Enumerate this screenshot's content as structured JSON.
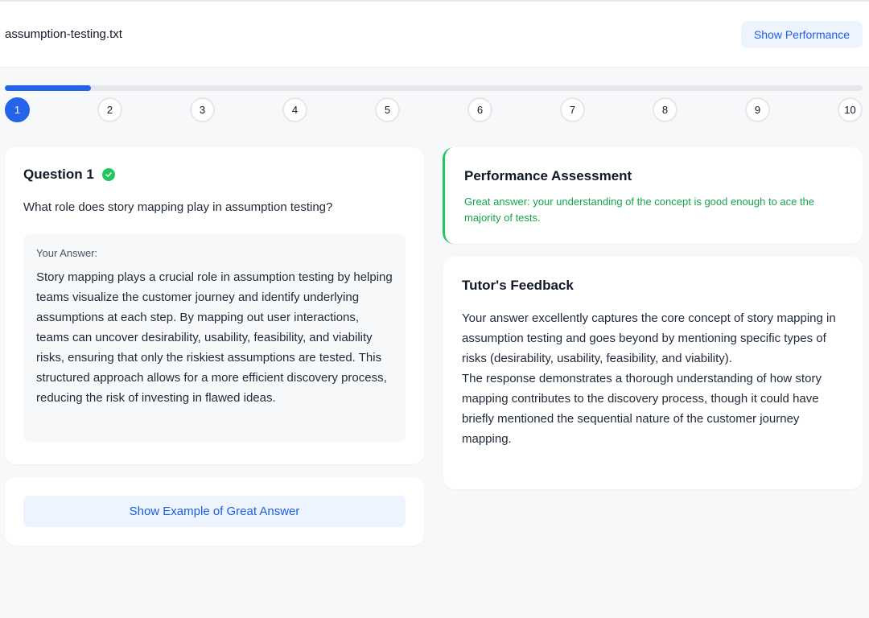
{
  "header": {
    "filename": "assumption-testing.txt",
    "show_performance_label": "Show Performance"
  },
  "progress": {
    "current_step": 1,
    "total_steps": 10,
    "fraction": 0.1,
    "steps": [
      "1",
      "2",
      "3",
      "4",
      "5",
      "6",
      "7",
      "8",
      "9",
      "10"
    ]
  },
  "question": {
    "title": "Question 1",
    "status_icon": "check-circle-icon",
    "text": "What role does story mapping play in assumption testing?",
    "answer_label": "Your Answer:",
    "answer_text": "Story mapping plays a crucial role in assumption testing by helping teams visualize the customer journey and identify underlying assumptions at each step. By mapping out user interactions, teams can uncover desirability, usability, feasibility, and viability risks, ensuring that only the riskiest assumptions are tested. This structured approach allows for a more efficient discovery process, reducing the risk of investing in flawed ideas."
  },
  "example": {
    "button_label": "Show Example of Great Answer"
  },
  "performance": {
    "title": "Performance Assessment",
    "text": "Great answer: your understanding of the concept is good enough to ace the majority of tests.",
    "accent_color": "#22c55e"
  },
  "feedback": {
    "title": "Tutor's Feedback",
    "paragraph_1": "Your answer excellently captures the core concept of story mapping in assumption testing and goes beyond by mentioning specific types of risks (desirability, usability, feasibility, and viability).",
    "paragraph_2": "The response demonstrates a thorough understanding of how story mapping contributes to the discovery process, though it could have briefly mentioned the sequential nature of the customer journey mapping."
  },
  "colors": {
    "primary": "#2563eb",
    "success": "#22c55e",
    "success_text": "#16a34a",
    "button_bg": "#eef4fe"
  }
}
